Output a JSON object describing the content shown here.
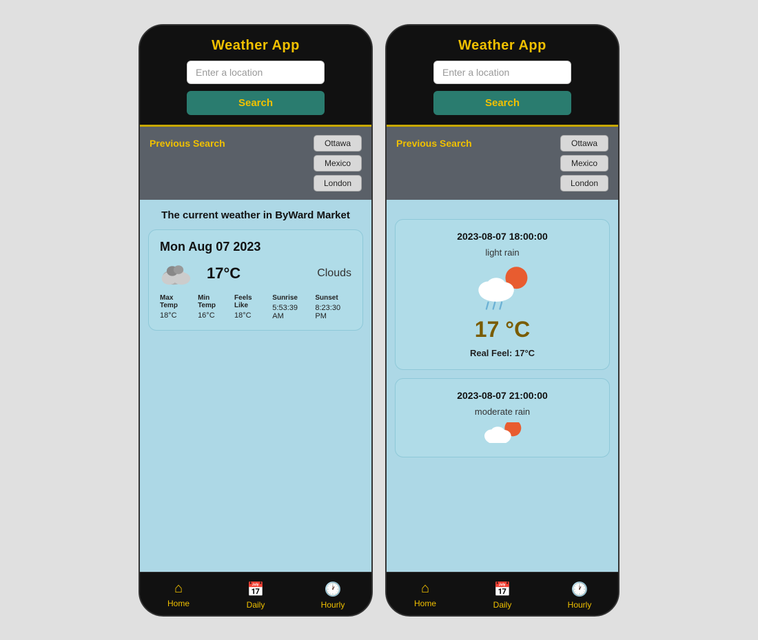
{
  "app": {
    "title": "Weather App",
    "input_placeholder": "Enter a location",
    "search_label": "Search"
  },
  "prev_search": {
    "label": "Previous Search",
    "buttons": [
      "Ottawa",
      "Mexico",
      "London"
    ]
  },
  "phone1": {
    "weather_title": "The current weather in ByWard Market",
    "card": {
      "date": "Mon Aug 07 2023",
      "temp": "17°C",
      "desc": "Clouds",
      "max_temp_label": "Max Temp",
      "max_temp": "18°C",
      "min_temp_label": "Min Temp",
      "min_temp": "16°C",
      "feels_label": "Feels Like",
      "feels": "18°C",
      "sunrise_label": "Sunrise",
      "sunrise": "5:53:39 AM",
      "sunset_label": "Sunset",
      "sunset": "8:23:30 PM"
    }
  },
  "phone2": {
    "hourly_card1": {
      "time": "2023-08-07 18:00:00",
      "desc": "light rain",
      "temp": "17 °C",
      "real_feel": "Real Feel: 17°C"
    },
    "hourly_card2": {
      "time": "2023-08-07 21:00:00",
      "desc": "moderate rain"
    }
  },
  "nav": {
    "home": "Home",
    "daily": "Daily",
    "hourly": "Hourly"
  }
}
